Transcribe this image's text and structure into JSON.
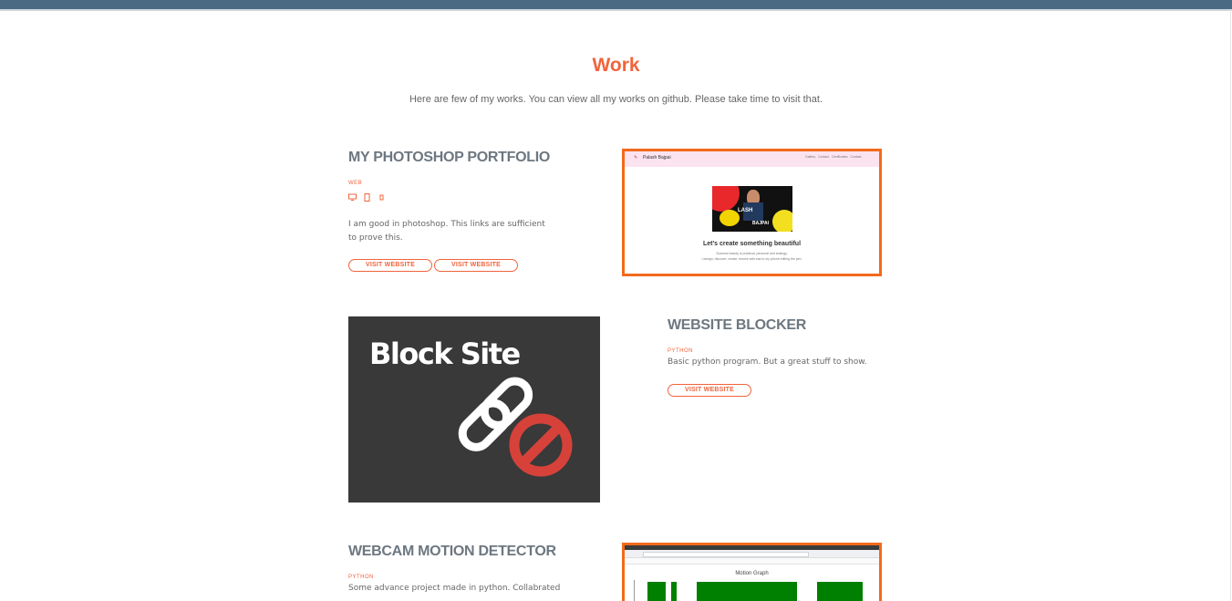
{
  "section": {
    "title": "Work",
    "subtitle": "Here are few of my works. You can view all my works on github. Please take time to visit that."
  },
  "projects": [
    {
      "title": "MY PHOTOSHOP PORTFOLIO",
      "tag": "WEB",
      "description_lines": [
        "I am good in photoshop. This links are sufficient",
        "to prove this."
      ],
      "buttons": [
        "VISIT WEBSITE",
        "VISIT WEBSITE"
      ],
      "icons": [
        "desktop-icon",
        "tablet-icon",
        "mobile-icon"
      ],
      "preview": {
        "brand": "Palash Bajpai",
        "nav": [
          "Gallery",
          "Contact",
          "Certificates",
          "Contact"
        ],
        "headline": "Let's create something beautiful",
        "name_line1": "LASH",
        "name_line2": "BAJPAI",
        "body_line1": "Success beauty is practical, personal and analogy.",
        "body_line2": "I design, discover, create, rework with eas to my phone editing the pen."
      }
    },
    {
      "title": "WEBSITE BLOCKER",
      "tag": "PYTHON",
      "description_lines": [
        "Basic python program. But a great stuff to show."
      ],
      "buttons": [
        "VISIT WEBSITE"
      ],
      "image": {
        "caption": "Block Site",
        "icons": [
          "link-icon",
          "block-icon"
        ]
      }
    },
    {
      "title": "WEBCAM MOTION DETECTOR",
      "tag": "PYTHON",
      "description_lines": [
        "Some advance project made in python. Collabrated"
      ],
      "preview": {
        "graph_title": "Motion Graph"
      }
    }
  ],
  "colors": {
    "accent": "#f0643c",
    "title": "#6d7780",
    "topbar": "#4a6a84",
    "frame": "#f26a1b",
    "block_bg": "#393939",
    "block_red": "#d6423a",
    "graph_green": "#008000"
  }
}
